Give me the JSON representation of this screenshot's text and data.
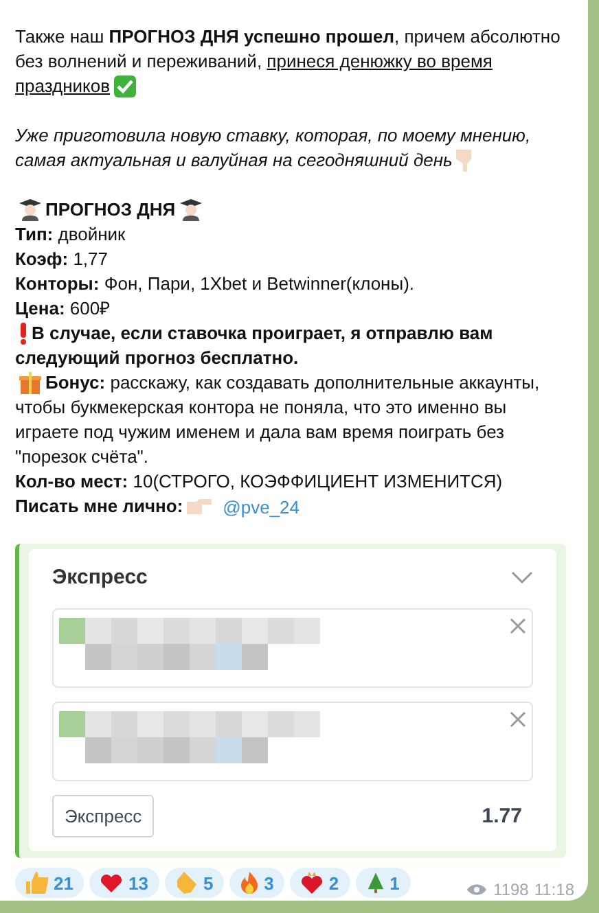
{
  "message": {
    "paragraphs": [
      {
        "lines": [
          {
            "kind": "plain",
            "text": "Также наш **ПРОГНОЗ ДНЯ успешно прошел**, причем абсолютно"
          },
          {
            "kind": "plain",
            "text": "без волнений и переживаний, ",
            "underlined": "принеся денюжку во время"
          },
          {
            "kind": "checked",
            "underlined": "праздников"
          }
        ]
      },
      {
        "lines": [
          {
            "kind": "note",
            "text": "Уже приготовила новую ставку, которая, по моему мнению,"
          },
          {
            "kind": "pointed",
            "text": "самая актуальная и валуйная на сегодняшний день"
          }
        ]
      },
      {
        "lines": [
          {
            "kind": "heading",
            "text": "ПРОГНОЗ ДНЯ"
          },
          {
            "kind": "plain",
            "text": "**Тип:** двойник"
          },
          {
            "kind": "plain",
            "text": "**Коэф:** 1,77"
          },
          {
            "kind": "plain",
            "text": "**Конторы:** Фон, Пари, 1Xbet и Betwinner(клоны)."
          },
          {
            "kind": "plain",
            "text": "**Цена:** 600₽"
          },
          {
            "kind": "warning",
            "text": "В случае, если ставочка проиграет, я отправлю вам"
          },
          {
            "kind": "bold",
            "text": "следующий прогноз бесплатно."
          },
          {
            "kind": "bonus",
            "text": "**Бонус:** расскажу, как создавать дополнительные аккаунты,"
          },
          {
            "kind": "plain",
            "text": "чтобы букмекерская контора не поняла, что это именно вы"
          },
          {
            "kind": "plain",
            "text": "играете под чужим именем и дала вам время поиграть без"
          },
          {
            "kind": "plain",
            "text": "\"порезок счёта\"."
          },
          {
            "kind": "plain",
            "text": "**Кол-во мест:** 10(СТРОГО, КОЭФФИЦИЕНТ ИЗМЕНИТСЯ)"
          },
          {
            "kind": "contact",
            "text": "Писать мне лично:",
            "mention": "@pve_24"
          }
        ]
      }
    ]
  },
  "attachment": {
    "title": "Экспресс",
    "bets": [
      {
        "kind": "blurred"
      },
      {
        "kind": "blurred"
      }
    ],
    "button": "Экспресс",
    "odds": "1.77"
  },
  "reactions": [
    {
      "kind": "thumbs-up",
      "count": "21"
    },
    {
      "kind": "heart",
      "count": "13"
    },
    {
      "kind": "clap",
      "count": "5"
    },
    {
      "kind": "fire",
      "count": "3"
    },
    {
      "kind": "heart-fire",
      "count": "2"
    },
    {
      "kind": "tree",
      "count": "1"
    }
  ],
  "footer": {
    "views": "1198",
    "time": "11:18"
  }
}
